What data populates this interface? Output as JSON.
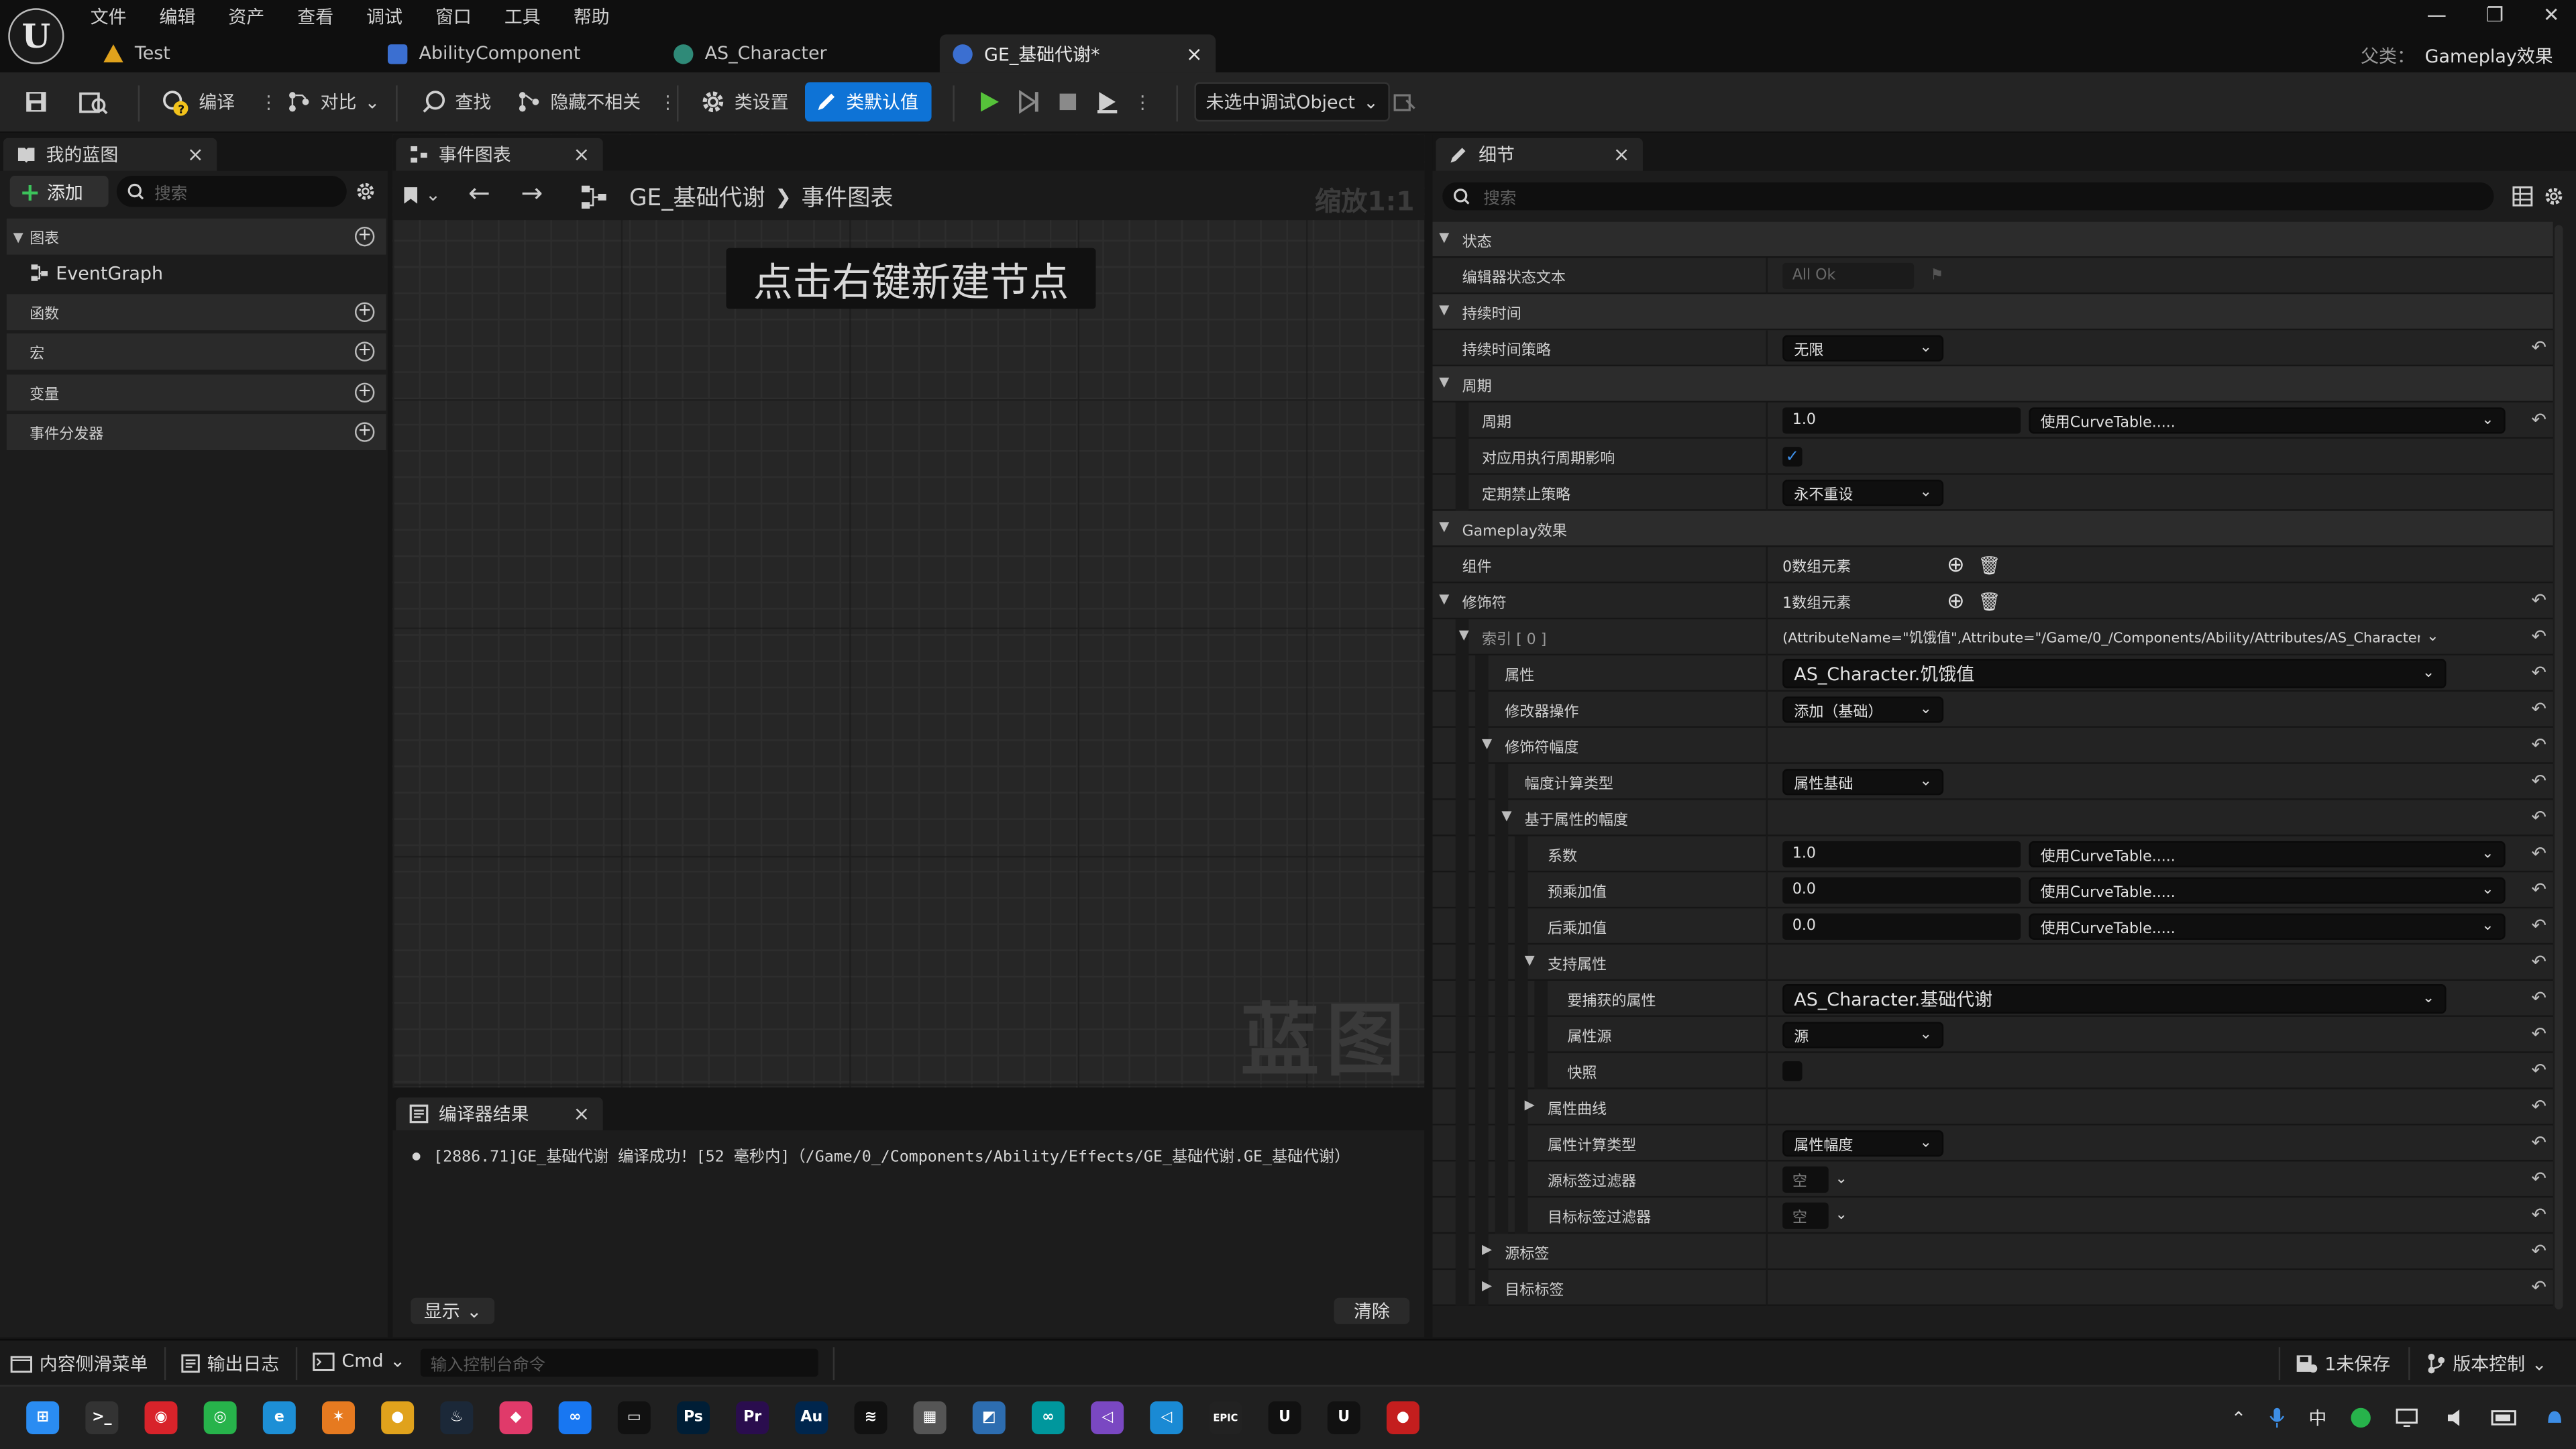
{
  "menu": [
    "文件",
    "编辑",
    "资产",
    "查看",
    "调试",
    "窗口",
    "工具",
    "帮助"
  ],
  "tabs": [
    {
      "label": "Test",
      "color": "#e0a21c"
    },
    {
      "label": "AbilityComponent",
      "color": "#3b6fd1"
    },
    {
      "label": "AS_Character",
      "color": "#2f8a78"
    },
    {
      "label": "GE_基础代谢*",
      "color": "#3b6fd1",
      "close": "×"
    }
  ],
  "window": {
    "minimize": "—",
    "restore": "❐",
    "close": "✕"
  },
  "parent": {
    "label": "父类：",
    "value": "Gameplay效果"
  },
  "toolbar": {
    "compile": "编译",
    "diff": "对比",
    "find": "查找",
    "hide_unrelated": "隐藏不相关",
    "class_settings": "类设置",
    "class_defaults": "类默认值",
    "debug_object": "未选中调试Object"
  },
  "my_blueprint": {
    "title": "我的蓝图",
    "close": "×",
    "add": "添加",
    "search_placeholder": "搜索",
    "sections": {
      "graphs": "图表",
      "event_graph": "EventGraph",
      "functions": "函数",
      "macros": "宏",
      "variables": "变量",
      "dispatchers": "事件分发器"
    }
  },
  "event_graph": {
    "tab": "事件图表",
    "close": "×",
    "crumb_root": "GE_基础代谢",
    "crumb_sep": "❯",
    "crumb_leaf": "事件图表",
    "zoom": "缩放1:1",
    "hint": "点击右键新建节点",
    "watermark": "蓝图"
  },
  "compiler": {
    "tab": "编译器结果",
    "close": "×",
    "message": "[2886.71]GE_基础代谢 编译成功！[52 毫秒内]（/Game/0_/Components/Ability/Effects/GE_基础代谢.GE_基础代谢）",
    "show": "显示",
    "clear": "清除"
  },
  "details": {
    "title": "细节",
    "close": "×",
    "search_placeholder": "搜索",
    "rows": [
      {
        "label": "状态",
        "cat": true,
        "tri": "open",
        "depth": 0
      },
      {
        "label": "编辑器状态文本",
        "depth": 1,
        "type": "text",
        "value": "All Ok",
        "muted": true
      },
      {
        "label": "持续时间",
        "cat": true,
        "tri": "open",
        "depth": 0
      },
      {
        "label": "持续时间策略",
        "depth": 1,
        "type": "combo",
        "value": "无限",
        "reset": true
      },
      {
        "label": "周期",
        "cat": true,
        "tri": "open",
        "depth": 0
      },
      {
        "label": "周期",
        "depth": 2,
        "type": "curve",
        "value": "1.0",
        "curve": "使用CurveTable.....",
        "reset": true
      },
      {
        "label": "对应用执行周期影响",
        "depth": 2,
        "type": "check",
        "checked": true
      },
      {
        "label": "定期禁止策略",
        "depth": 2,
        "type": "combo",
        "value": "永不重设"
      },
      {
        "label": "Gameplay效果",
        "cat": true,
        "tri": "open",
        "depth": 0
      },
      {
        "label": "组件",
        "depth": 1,
        "type": "array",
        "value": "0数组元素"
      },
      {
        "label": "修饰符",
        "depth": 1,
        "tri": "open",
        "type": "array",
        "value": "1数组元素",
        "reset": true
      },
      {
        "label": "索引 [ 0 ]",
        "depth": 2,
        "tri": "open",
        "type": "long",
        "value": "(AttributeName=\"饥饿值\",Attribute=\"/Game/0_/Components/Ability/Attributes/AS_Character.AS_C",
        "reset": true,
        "muted_label": true
      },
      {
        "label": "属性",
        "depth": 3,
        "type": "wide",
        "value": "AS_Character.饥饿值",
        "reset": true
      },
      {
        "label": "修改器操作",
        "depth": 3,
        "type": "combo",
        "value": "添加（基础）",
        "reset": true
      },
      {
        "label": "修饰符幅度",
        "depth": 3,
        "tri": "open",
        "type": "none",
        "reset": true
      },
      {
        "label": "幅度计算类型",
        "depth": 4,
        "type": "combo",
        "value": "属性基础",
        "reset": true
      },
      {
        "label": "基于属性的幅度",
        "depth": 4,
        "tri": "open",
        "type": "none",
        "reset": true
      },
      {
        "label": "系数",
        "depth": 5,
        "type": "curve",
        "value": "1.0",
        "curve": "使用CurveTable.....",
        "reset": true
      },
      {
        "label": "预乘加值",
        "depth": 5,
        "type": "curve",
        "value": "0.0",
        "curve": "使用CurveTable.....",
        "reset": true
      },
      {
        "label": "后乘加值",
        "depth": 5,
        "type": "curve",
        "value": "0.0",
        "curve": "使用CurveTable.....",
        "reset": true
      },
      {
        "label": "支持属性",
        "depth": 5,
        "tri": "open",
        "type": "none",
        "reset": true
      },
      {
        "label": "要捕获的属性",
        "depth": 6,
        "type": "wide",
        "value": "AS_Character.基础代谢",
        "reset": true
      },
      {
        "label": "属性源",
        "depth": 6,
        "type": "combo",
        "value": "源",
        "reset": true
      },
      {
        "label": "快照",
        "depth": 6,
        "type": "check",
        "checked": false,
        "reset": true
      },
      {
        "label": "属性曲线",
        "depth": 5,
        "tri": "closed",
        "type": "none",
        "reset": true
      },
      {
        "label": "属性计算类型",
        "depth": 5,
        "type": "combo",
        "value": "属性幅度",
        "reset": true
      },
      {
        "label": "源标签过滤器",
        "depth": 5,
        "type": "small",
        "value": "空",
        "reset": true
      },
      {
        "label": "目标标签过滤器",
        "depth": 5,
        "type": "small",
        "value": "空",
        "reset": true
      },
      {
        "label": "源标签",
        "depth": 3,
        "tri": "closed",
        "type": "none",
        "reset": true
      },
      {
        "label": "目标标签",
        "depth": 3,
        "tri": "closed",
        "type": "none",
        "reset": true
      }
    ]
  },
  "statusbar": {
    "content_drawer": "内容侧滑菜单",
    "output_log": "输出日志",
    "cmd": "Cmd",
    "console_placeholder": "输入控制台命令",
    "unsaved": "1未保存",
    "source_control": "版本控制"
  },
  "taskbar": {
    "apps": [
      {
        "name": "start",
        "glyph": "⊞",
        "color": "#2a8cf2"
      },
      {
        "name": "terminal",
        "glyph": ">_",
        "color": "#333333"
      },
      {
        "name": "netease-music",
        "glyph": "◉",
        "color": "#d8232a"
      },
      {
        "name": "wechat",
        "glyph": "◎",
        "color": "#27b34b"
      },
      {
        "name": "edge",
        "glyph": "e",
        "color": "#1d8fd6"
      },
      {
        "name": "butterfly",
        "glyph": "✶",
        "color": "#e67a20"
      },
      {
        "name": "chrome",
        "glyph": "●",
        "color": "#e0a21c"
      },
      {
        "name": "steam",
        "glyph": "♨",
        "color": "#1b2838"
      },
      {
        "name": "app-pink",
        "glyph": "◆",
        "color": "#e03a6a"
      },
      {
        "name": "meta",
        "glyph": "∞",
        "color": "#1877f2"
      },
      {
        "name": "oculus",
        "glyph": "▭",
        "color": "#111111"
      },
      {
        "name": "photoshop",
        "glyph": "Ps",
        "color": "#001e36"
      },
      {
        "name": "premiere",
        "glyph": "Pr",
        "color": "#2a0d4e"
      },
      {
        "name": "audition",
        "glyph": "Au",
        "color": "#00264d"
      },
      {
        "name": "capcut",
        "glyph": "≋",
        "color": "#111111"
      },
      {
        "name": "calculator",
        "glyph": "▦",
        "color": "#555555"
      },
      {
        "name": "paint",
        "glyph": "◩",
        "color": "#2d6db0"
      },
      {
        "name": "arduino",
        "glyph": "∞",
        "color": "#00979d"
      },
      {
        "name": "visual-studio",
        "glyph": "◁",
        "color": "#7a48c2"
      },
      {
        "name": "vscode",
        "glyph": "◁",
        "color": "#1a8ad4"
      },
      {
        "name": "epic",
        "glyph": "EPIC",
        "color": "#222222"
      },
      {
        "name": "unreal-1",
        "glyph": "U",
        "color": "#111111"
      },
      {
        "name": "unreal-2",
        "glyph": "U",
        "color": "#111111"
      },
      {
        "name": "recorder",
        "glyph": "●",
        "color": "#c41e1e"
      }
    ],
    "tray_ime": "中"
  }
}
